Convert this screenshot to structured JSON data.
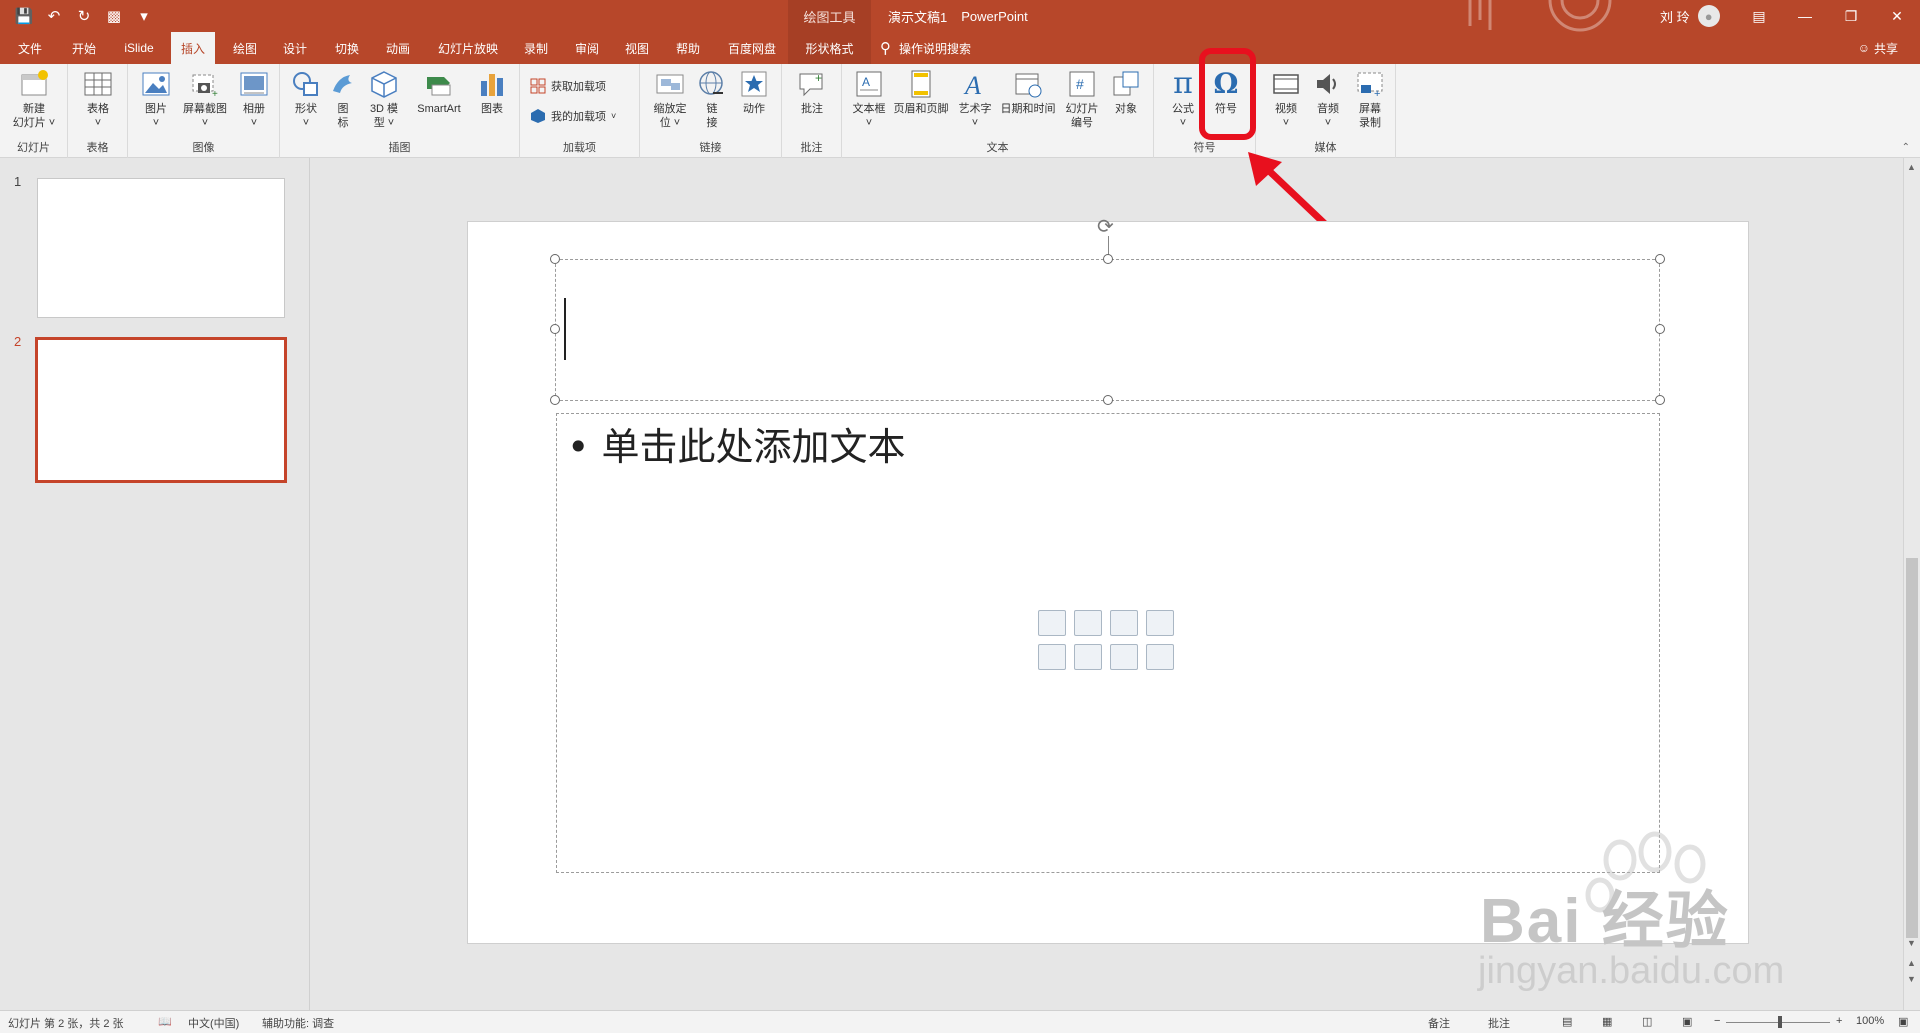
{
  "window": {
    "doc_name": "演示文稿1",
    "app_name": "PowerPoint",
    "context_tab_group": "绘图工具",
    "user_name": "刘 玲"
  },
  "tabs": [
    {
      "label": "文件"
    },
    {
      "label": "开始"
    },
    {
      "label": "iSlide"
    },
    {
      "label": "插入"
    },
    {
      "label": "绘图"
    },
    {
      "label": "设计"
    },
    {
      "label": "切换"
    },
    {
      "label": "动画"
    },
    {
      "label": "幻灯片放映"
    },
    {
      "label": "录制"
    },
    {
      "label": "审阅"
    },
    {
      "label": "视图"
    },
    {
      "label": "帮助"
    },
    {
      "label": "百度网盘"
    },
    {
      "label": "形状格式"
    }
  ],
  "tell_me": "操作说明搜索",
  "share": "共享",
  "ribbon": {
    "slides": {
      "label": "幻灯片",
      "new_slide": "新建\n幻灯片 ˅"
    },
    "tables": {
      "label": "表格",
      "table": "表格\n˅"
    },
    "images": {
      "label": "图像",
      "pictures": "图片\n˅",
      "screenshot": "屏幕截图\n˅",
      "album": "相册\n˅"
    },
    "illustrations": {
      "label": "插图",
      "shapes": "形状\n˅",
      "icons": "图\n标",
      "model3d": "3D 模\n型 ˅",
      "smartart": "SmartArt",
      "chart": "图表"
    },
    "addins": {
      "label": "加载项",
      "get": "获取加载项",
      "mine": "我的加载项"
    },
    "links": {
      "label": "链接",
      "zoom": "缩放定\n位 ˅",
      "link": "链\n接",
      "action": "动作"
    },
    "comments": {
      "label": "批注",
      "comment": "批注"
    },
    "text": {
      "label": "文本",
      "textbox": "文本框\n˅",
      "header_footer": "页眉和页脚",
      "wordart": "艺术字\n˅",
      "datetime": "日期和时间",
      "slide_number": "幻灯片\n编号",
      "object": "对象"
    },
    "symbols": {
      "label": "符号",
      "equation": "公式\n˅",
      "symbol": "符号"
    },
    "media": {
      "label": "媒体",
      "video": "视频\n˅",
      "audio": "音频\n˅",
      "screen_rec": "屏幕\n录制"
    }
  },
  "thumbnails": [
    {
      "number": "1"
    },
    {
      "number": "2"
    }
  ],
  "slide": {
    "body_placeholder": "• 单击此处添加文本"
  },
  "watermark": {
    "brand": "Bai 经验",
    "url": "jingyan.baidu.com"
  },
  "status": {
    "slide_info": "幻灯片 第 2 张，共 2 张",
    "language": "中文(中国)",
    "accessibility": "辅助功能: 调查",
    "notes": "备注",
    "comments": "批注",
    "zoom": "100%"
  },
  "colors": {
    "accent": "#b7472a",
    "highlight": "#e8101e"
  }
}
